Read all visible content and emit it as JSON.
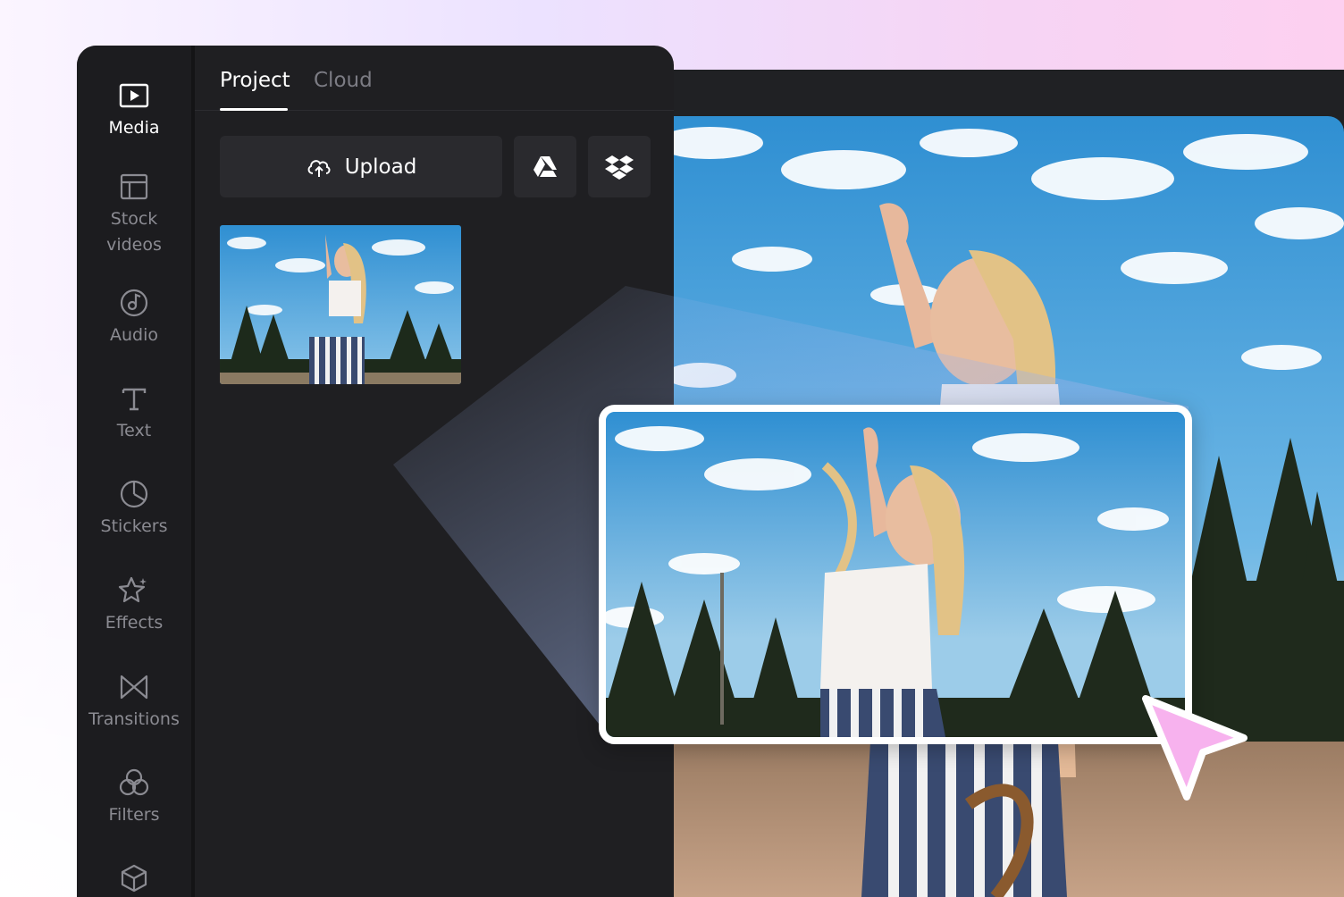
{
  "tabs": [
    {
      "label": "Project",
      "active": true
    },
    {
      "label": "Cloud",
      "active": false
    }
  ],
  "sidebar": {
    "items": [
      {
        "label": "Media",
        "icon": "media-icon",
        "active": true
      },
      {
        "label": "Stock\nvideos",
        "icon": "stock-videos-icon",
        "active": false
      },
      {
        "label": "Audio",
        "icon": "audio-icon",
        "active": false
      },
      {
        "label": "Text",
        "icon": "text-icon",
        "active": false
      },
      {
        "label": "Stickers",
        "icon": "stickers-icon",
        "active": false
      },
      {
        "label": "Effects",
        "icon": "effects-icon",
        "active": false
      },
      {
        "label": "Transitions",
        "icon": "transitions-icon",
        "active": false
      },
      {
        "label": "Filters",
        "icon": "filters-icon",
        "active": false
      },
      {
        "label": "",
        "icon": "cube-icon",
        "active": false
      }
    ]
  },
  "media": {
    "upload_label": "Upload",
    "upload_icon": "cloud-upload-icon",
    "integrations": [
      "google-drive-icon",
      "dropbox-icon"
    ]
  },
  "colors": {
    "panel": "#1f1f22",
    "sidebar": "#1c1c1f",
    "sky": "#3b9ed8",
    "cursor": "#f7b2ee",
    "text_active": "#ffffff",
    "text_muted": "#8b8b92"
  }
}
